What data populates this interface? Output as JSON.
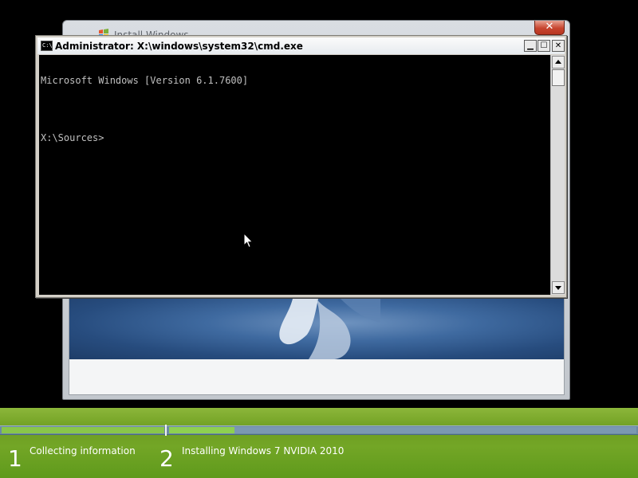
{
  "install_window": {
    "title": "Install Windows",
    "close_icon": "close-icon",
    "colors": {
      "close_red": "#c7452f",
      "banner_blue": "#3f6aa0"
    }
  },
  "cmd_window": {
    "title": "Administrator: X:\\windows\\system32\\cmd.exe",
    "app_icon_text": "C:\\",
    "buttons": {
      "minimize_glyph": "▁",
      "maximize_glyph": "☐",
      "close_glyph": "✕"
    },
    "console_lines": [
      "Microsoft Windows [Version 6.1.7600]",
      "",
      "X:\\Sources>"
    ],
    "scroll_position": 0
  },
  "progress": {
    "overall_fraction": 0.36,
    "steps": [
      {
        "number": "1",
        "label": "Collecting information",
        "complete": true
      },
      {
        "number": "2",
        "label": "Installing Windows 7 NVIDIA 2010",
        "fraction": 0.14
      }
    ],
    "colors": {
      "bar_green": "#89c64a",
      "bar_track": "#7b98b2",
      "band_green": "#73a626"
    }
  }
}
